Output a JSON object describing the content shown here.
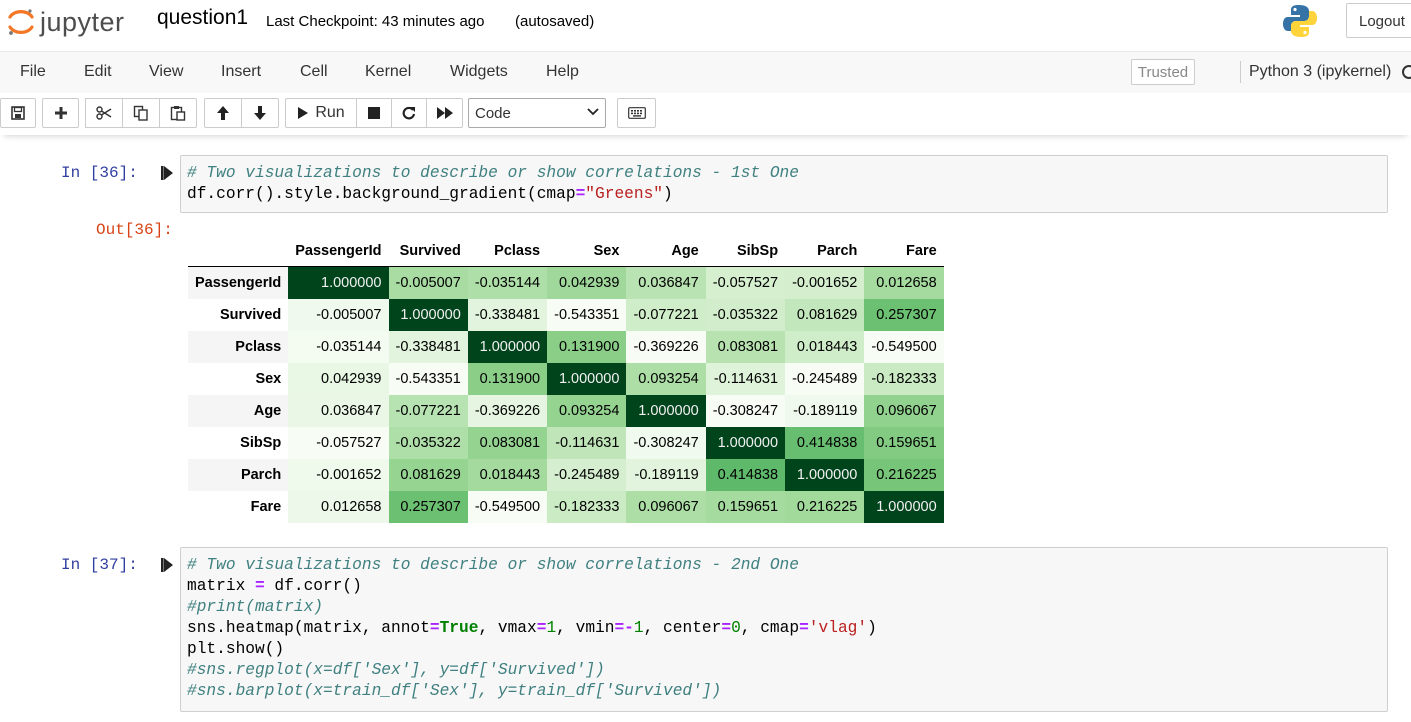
{
  "header": {
    "logo_text": "jupyter",
    "notebook_name": "question1",
    "checkpoint": "Last Checkpoint: 43 minutes ago",
    "autosave": "(autosaved)",
    "logout_label": "Logout"
  },
  "menubar": {
    "items": [
      "File",
      "Edit",
      "View",
      "Insert",
      "Cell",
      "Kernel",
      "Widgets",
      "Help"
    ],
    "trusted_label": "Trusted",
    "kernel_name": "Python 3 (ipykernel)"
  },
  "toolbar": {
    "run_label": "Run",
    "cell_type": "Code",
    "icons": [
      "save-icon",
      "plus-icon",
      "scissors-icon",
      "copy-icon",
      "paste-icon",
      "arrow-up-icon",
      "arrow-down-icon",
      "play-icon",
      "stop-icon",
      "restart-icon",
      "fast-forward-icon",
      "keyboard-icon"
    ]
  },
  "cells": [
    {
      "prompt": "In [36]:",
      "output_prompt": "Out[36]:",
      "code_lines": [
        [
          {
            "t": "# Two visualizations to describe or show correlations - 1st One",
            "c": "com"
          }
        ],
        [
          {
            "t": "df.corr().style.background_gradient(cmap",
            "c": ""
          },
          {
            "t": "=",
            "c": "op"
          },
          {
            "t": "\"Greens\"",
            "c": "str"
          },
          {
            "t": ")",
            "c": ""
          }
        ]
      ]
    },
    {
      "prompt": "In [37]:",
      "code_lines": [
        [
          {
            "t": "# Two visualizations to describe or show correlations - 2nd One",
            "c": "com"
          }
        ],
        [
          {
            "t": "matrix ",
            "c": ""
          },
          {
            "t": "=",
            "c": "op"
          },
          {
            "t": " df.corr()",
            "c": ""
          }
        ],
        [
          {
            "t": "#print(matrix)",
            "c": "com"
          }
        ],
        [
          {
            "t": "sns.heatmap(matrix, annot",
            "c": ""
          },
          {
            "t": "=",
            "c": "op"
          },
          {
            "t": "True",
            "c": "kw"
          },
          {
            "t": ", vmax",
            "c": ""
          },
          {
            "t": "=",
            "c": "op"
          },
          {
            "t": "1",
            "c": "num"
          },
          {
            "t": ", vmin",
            "c": ""
          },
          {
            "t": "=-",
            "c": "op"
          },
          {
            "t": "1",
            "c": "num"
          },
          {
            "t": ", center",
            "c": ""
          },
          {
            "t": "=",
            "c": "op"
          },
          {
            "t": "0",
            "c": "num"
          },
          {
            "t": ", cmap",
            "c": ""
          },
          {
            "t": "=",
            "c": "op"
          },
          {
            "t": "'vlag'",
            "c": "str"
          },
          {
            "t": ")",
            "c": ""
          }
        ],
        [
          {
            "t": "plt.show()",
            "c": ""
          }
        ],
        [
          {
            "t": "#sns.regplot(x=df['Sex'], y=df['Survived'])",
            "c": "com"
          }
        ],
        [
          {
            "t": "#sns.barplot(x=train_df['Sex'], y=train_df['Survived'])",
            "c": "com"
          }
        ]
      ]
    }
  ],
  "corr_table": {
    "columns": [
      "PassengerId",
      "Survived",
      "Pclass",
      "Sex",
      "Age",
      "SibSp",
      "Parch",
      "Fare"
    ],
    "rows": [
      {
        "name": "PassengerId",
        "values": [
          "1.000000",
          "-0.005007",
          "-0.035144",
          "0.042939",
          "0.036847",
          "-0.057527",
          "-0.001652",
          "0.012658"
        ]
      },
      {
        "name": "Survived",
        "values": [
          "-0.005007",
          "1.000000",
          "-0.338481",
          "-0.543351",
          "-0.077221",
          "-0.035322",
          "0.081629",
          "0.257307"
        ]
      },
      {
        "name": "Pclass",
        "values": [
          "-0.035144",
          "-0.338481",
          "1.000000",
          "0.131900",
          "-0.369226",
          "0.083081",
          "0.018443",
          "-0.549500"
        ]
      },
      {
        "name": "Sex",
        "values": [
          "0.042939",
          "-0.543351",
          "0.131900",
          "1.000000",
          "0.093254",
          "-0.114631",
          "-0.245489",
          "-0.182333"
        ]
      },
      {
        "name": "Age",
        "values": [
          "0.036847",
          "-0.077221",
          "-0.369226",
          "0.093254",
          "1.000000",
          "-0.308247",
          "-0.189119",
          "0.096067"
        ]
      },
      {
        "name": "SibSp",
        "values": [
          "-0.057527",
          "-0.035322",
          "0.083081",
          "-0.114631",
          "-0.308247",
          "1.000000",
          "0.414838",
          "0.159651"
        ]
      },
      {
        "name": "Parch",
        "values": [
          "-0.001652",
          "0.081629",
          "0.018443",
          "-0.245489",
          "-0.189119",
          "0.414838",
          "1.000000",
          "0.216225"
        ]
      },
      {
        "name": "Fare",
        "values": [
          "0.012658",
          "0.257307",
          "-0.549500",
          "-0.182333",
          "0.096067",
          "0.159651",
          "0.216225",
          "1.000000"
        ]
      }
    ],
    "colormap": "Greens"
  }
}
